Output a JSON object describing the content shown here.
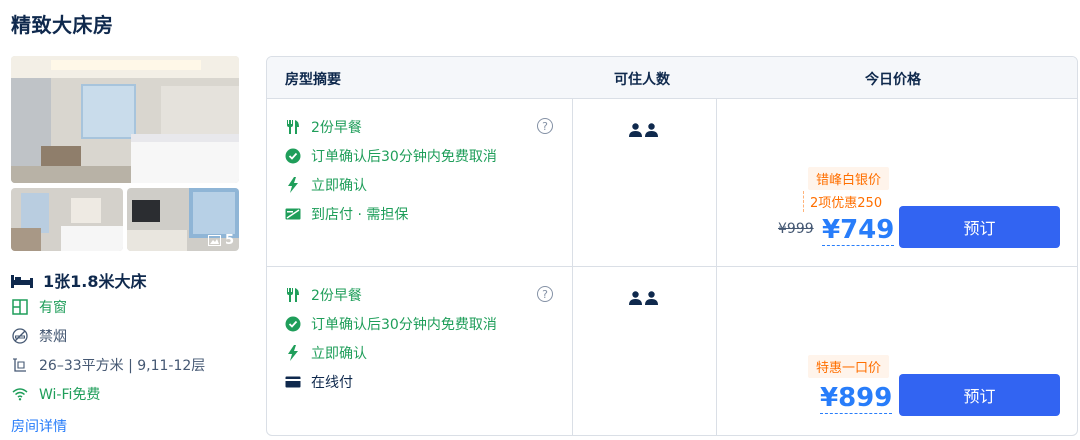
{
  "room": {
    "title": "精致大床房",
    "photo_count": "5",
    "bed": "1张1.8米大床",
    "window": "有窗",
    "smoking": "禁烟",
    "area": "26–33平方米 | 9,11-12层",
    "wifi": "Wi-Fi免费",
    "details_link": "房间详情"
  },
  "table": {
    "headers": [
      "房型摘要",
      "可住人数",
      "今日价格"
    ]
  },
  "rates": [
    {
      "breakfast": "2份早餐",
      "cancel": "订单确认后30分钟内免费取消",
      "confirm": "立即确认",
      "payment": "到店付 · 需担保",
      "promo_tag": "错峰白银价",
      "promo_sub": "2项优惠250",
      "old_price": "¥999",
      "price": "¥749",
      "book": "预订"
    },
    {
      "breakfast": "2份早餐",
      "cancel": "订单确认后30分钟内免费取消",
      "confirm": "立即确认",
      "payment": "在线付",
      "promo_tag": "特惠一口价",
      "price": "¥899",
      "book": "预订"
    }
  ],
  "colors": {
    "accent_blue": "#287dfa",
    "button_blue": "#3264f2",
    "green": "#1f9e5a",
    "promo_orange": "#ff6f00"
  }
}
